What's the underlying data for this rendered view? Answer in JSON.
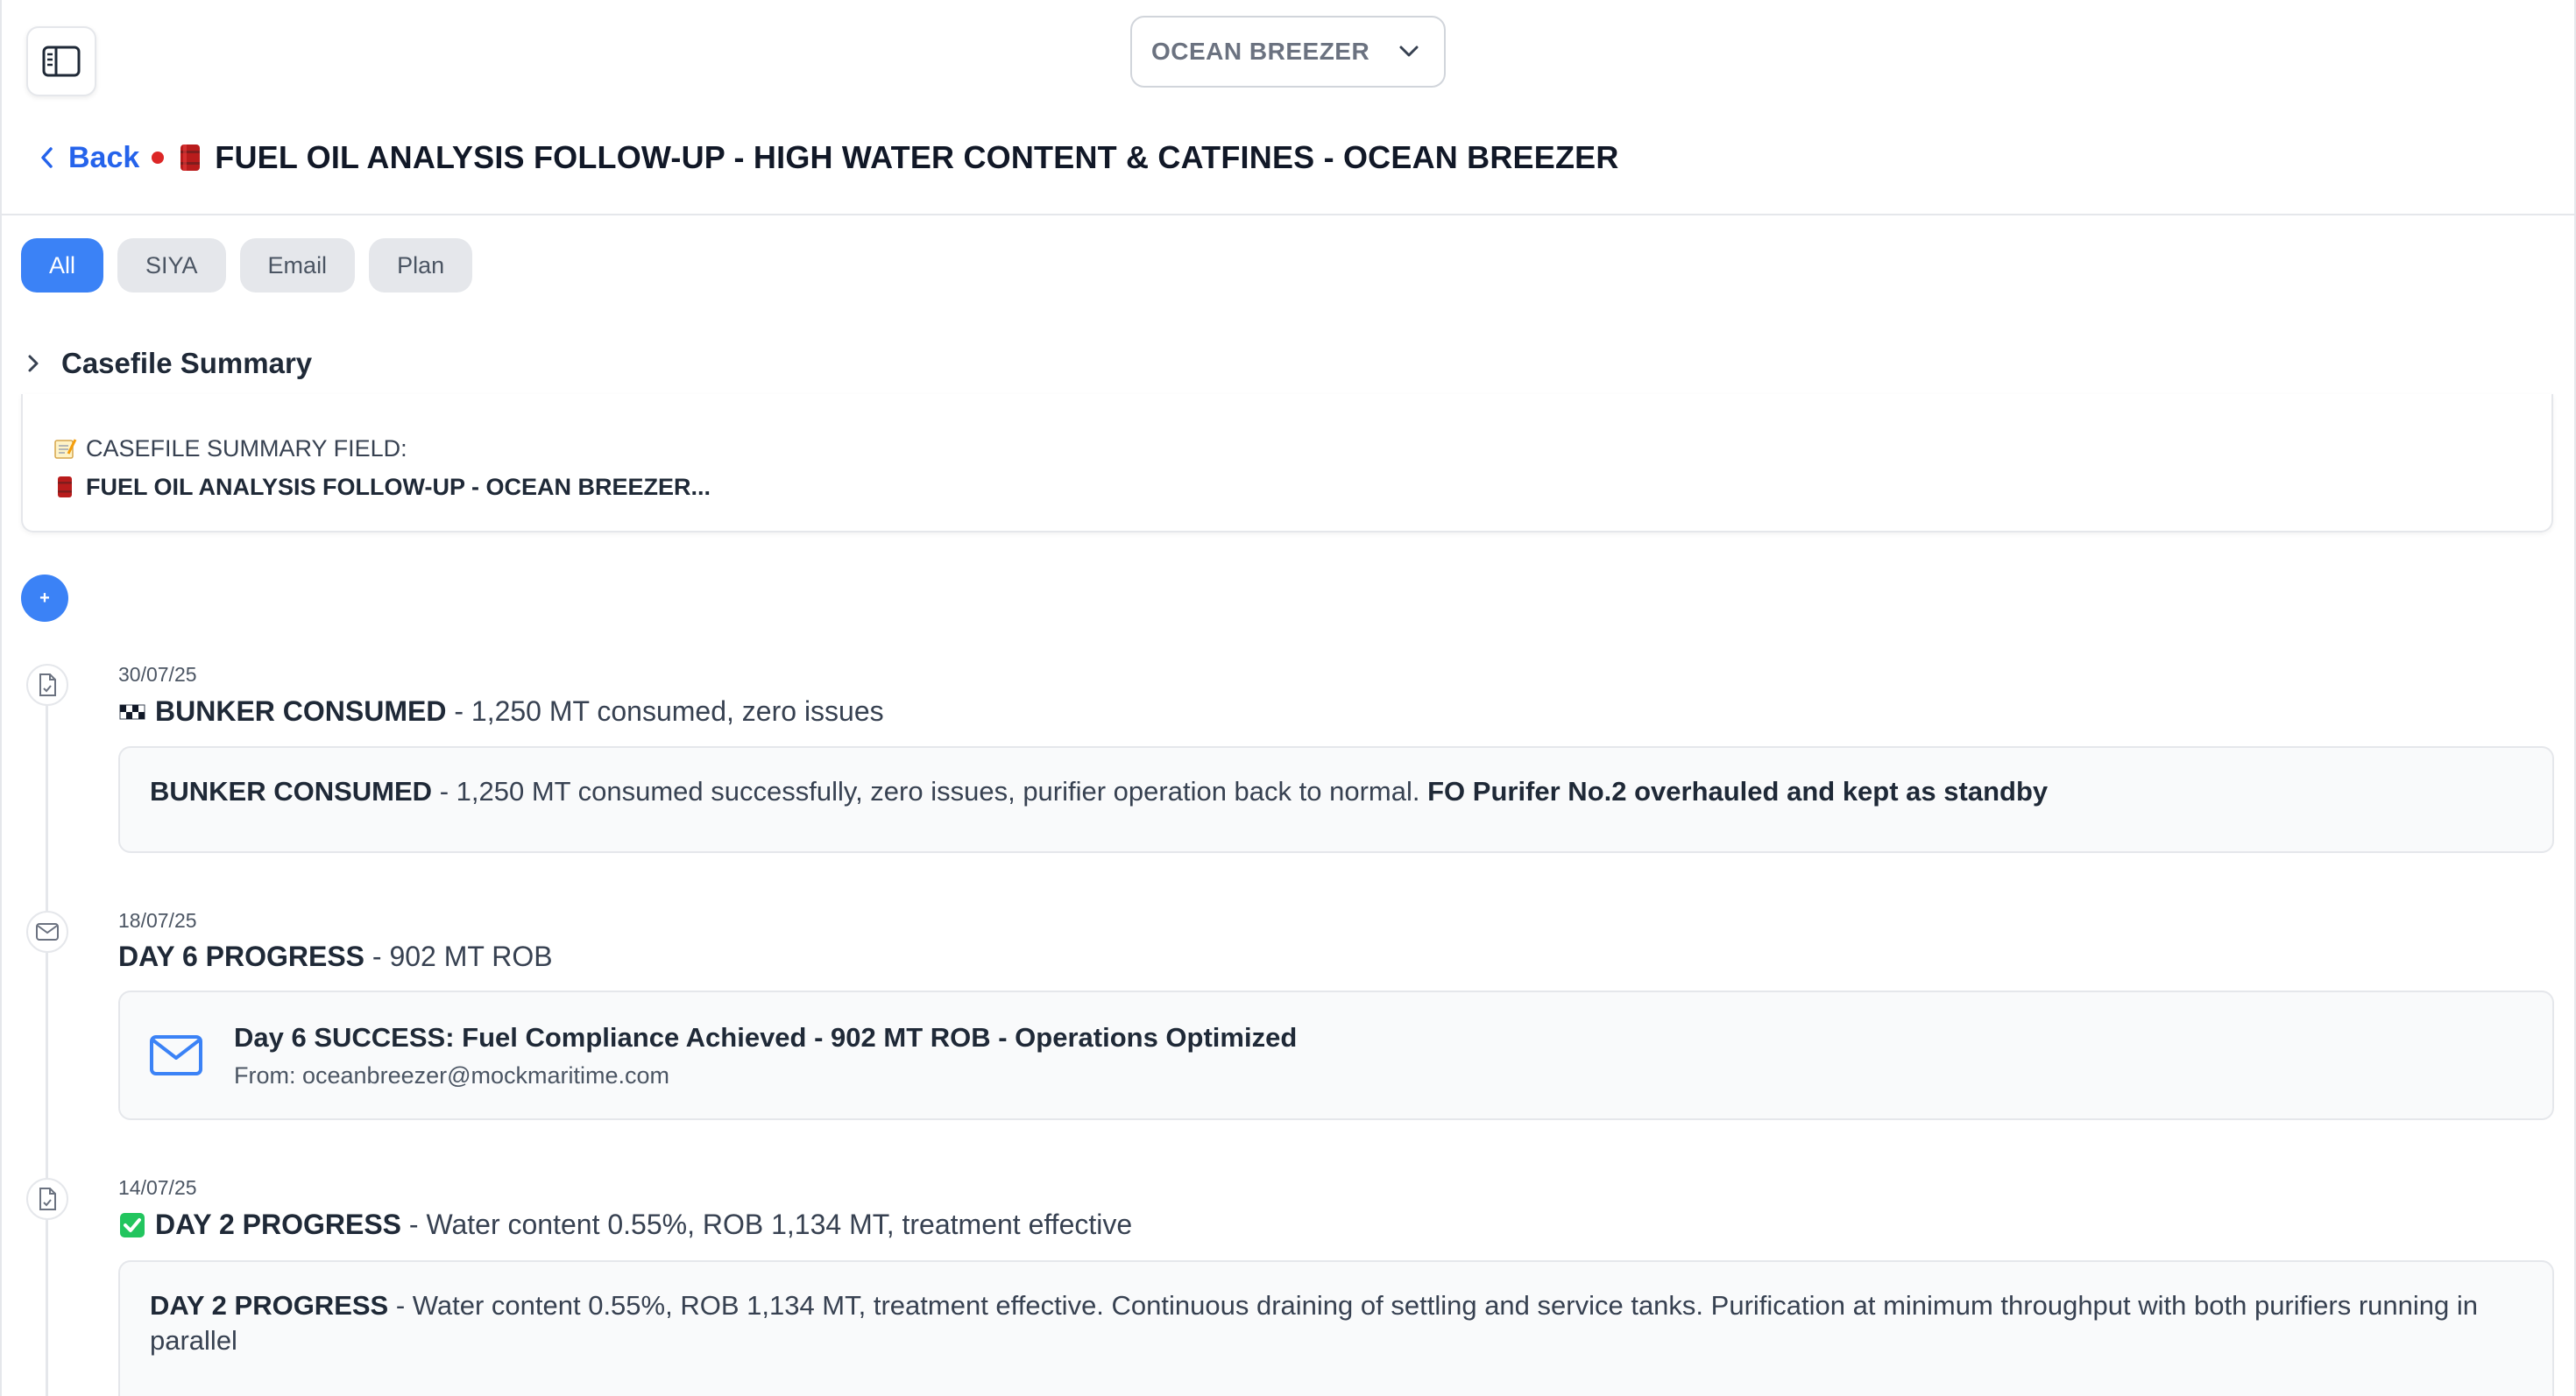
{
  "header": {
    "vessel_select": "OCEAN BREEZER",
    "back_label": "Back",
    "title": "FUEL OIL ANALYSIS FOLLOW-UP - HIGH WATER CONTENT & CATFINES - OCEAN BREEZER"
  },
  "tabs": [
    {
      "label": "All",
      "active": true
    },
    {
      "label": "SIYA",
      "active": false
    },
    {
      "label": "Email",
      "active": false
    },
    {
      "label": "Plan",
      "active": false
    }
  ],
  "summary": {
    "title": "Casefile Summary",
    "field_label": "CASEFILE SUMMARY FIELD:",
    "field_value": "FUEL OIL ANALYSIS FOLLOW-UP - OCEAN BREEZER..."
  },
  "add_button": "+",
  "timeline": [
    {
      "type": "note",
      "date": "30/07/25",
      "headline_bold": "BUNKER CONSUMED",
      "headline_rest": " - 1,250 MT consumed, zero issues",
      "body_bold": "BUNKER CONSUMED",
      "body_rest": " - 1,250 MT consumed successfully, zero issues, purifier operation back to normal. ",
      "body_bold2": "FO Purifer No.2 overhauled and kept as standby"
    },
    {
      "type": "email",
      "date": "18/07/25",
      "headline_bold": "DAY 6 PROGRESS",
      "headline_rest": " - 902 MT ROB",
      "subject": "Day 6 SUCCESS: Fuel Compliance Achieved - 902 MT ROB - Operations Optimized",
      "from": "From: oceanbreezer@mockmaritime.com"
    },
    {
      "type": "note",
      "date": "14/07/25",
      "headline_bold": "DAY 2 PROGRESS",
      "headline_rest": " - Water content 0.55%, ROB 1,134 MT, treatment effective",
      "body_bold": "DAY 2 PROGRESS",
      "body_rest": " - Water content 0.55%, ROB 1,134 MT, treatment effective. Continuous draining of settling and service tanks. Purification at minimum throughput with both purifiers running in parallel"
    }
  ],
  "colors": {
    "accent": "#3b82f6",
    "link": "#2563eb",
    "dot": "#dc2626",
    "check": "#22c55e"
  }
}
